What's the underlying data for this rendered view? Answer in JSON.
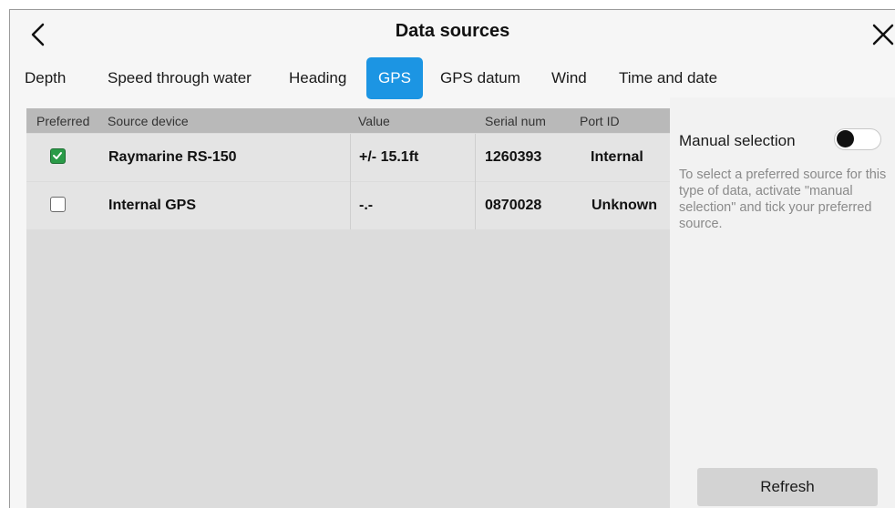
{
  "header": {
    "title": "Data sources",
    "back_icon": "chevron-left-icon",
    "close_icon": "close-icon"
  },
  "tabs": [
    {
      "label": "Depth",
      "active": false
    },
    {
      "label": "Speed through water",
      "active": false
    },
    {
      "label": "Heading",
      "active": false
    },
    {
      "label": "GPS",
      "active": true
    },
    {
      "label": "GPS datum",
      "active": false
    },
    {
      "label": "Wind",
      "active": false
    },
    {
      "label": "Time and date",
      "active": false
    }
  ],
  "table": {
    "columns": [
      "Preferred",
      "Source device",
      "Value",
      "Serial num",
      "Port ID"
    ],
    "rows": [
      {
        "preferred": true,
        "source_device": "Raymarine RS-150",
        "value": "+/- 15.1ft",
        "serial_num": "1260393",
        "port_id": "Internal"
      },
      {
        "preferred": false,
        "source_device": "Internal GPS",
        "value": "-.-",
        "serial_num": "0870028",
        "port_id": "Unknown"
      }
    ]
  },
  "panel": {
    "manual_selection_label": "Manual selection",
    "manual_selection_on": false,
    "help_text": "To select a preferred source for this type of data, activate \"manual selection\" and tick your preferred source.",
    "refresh_label": "Refresh"
  },
  "colors": {
    "accent": "#1c95e3",
    "checkbox_checked": "#2a9b48"
  }
}
